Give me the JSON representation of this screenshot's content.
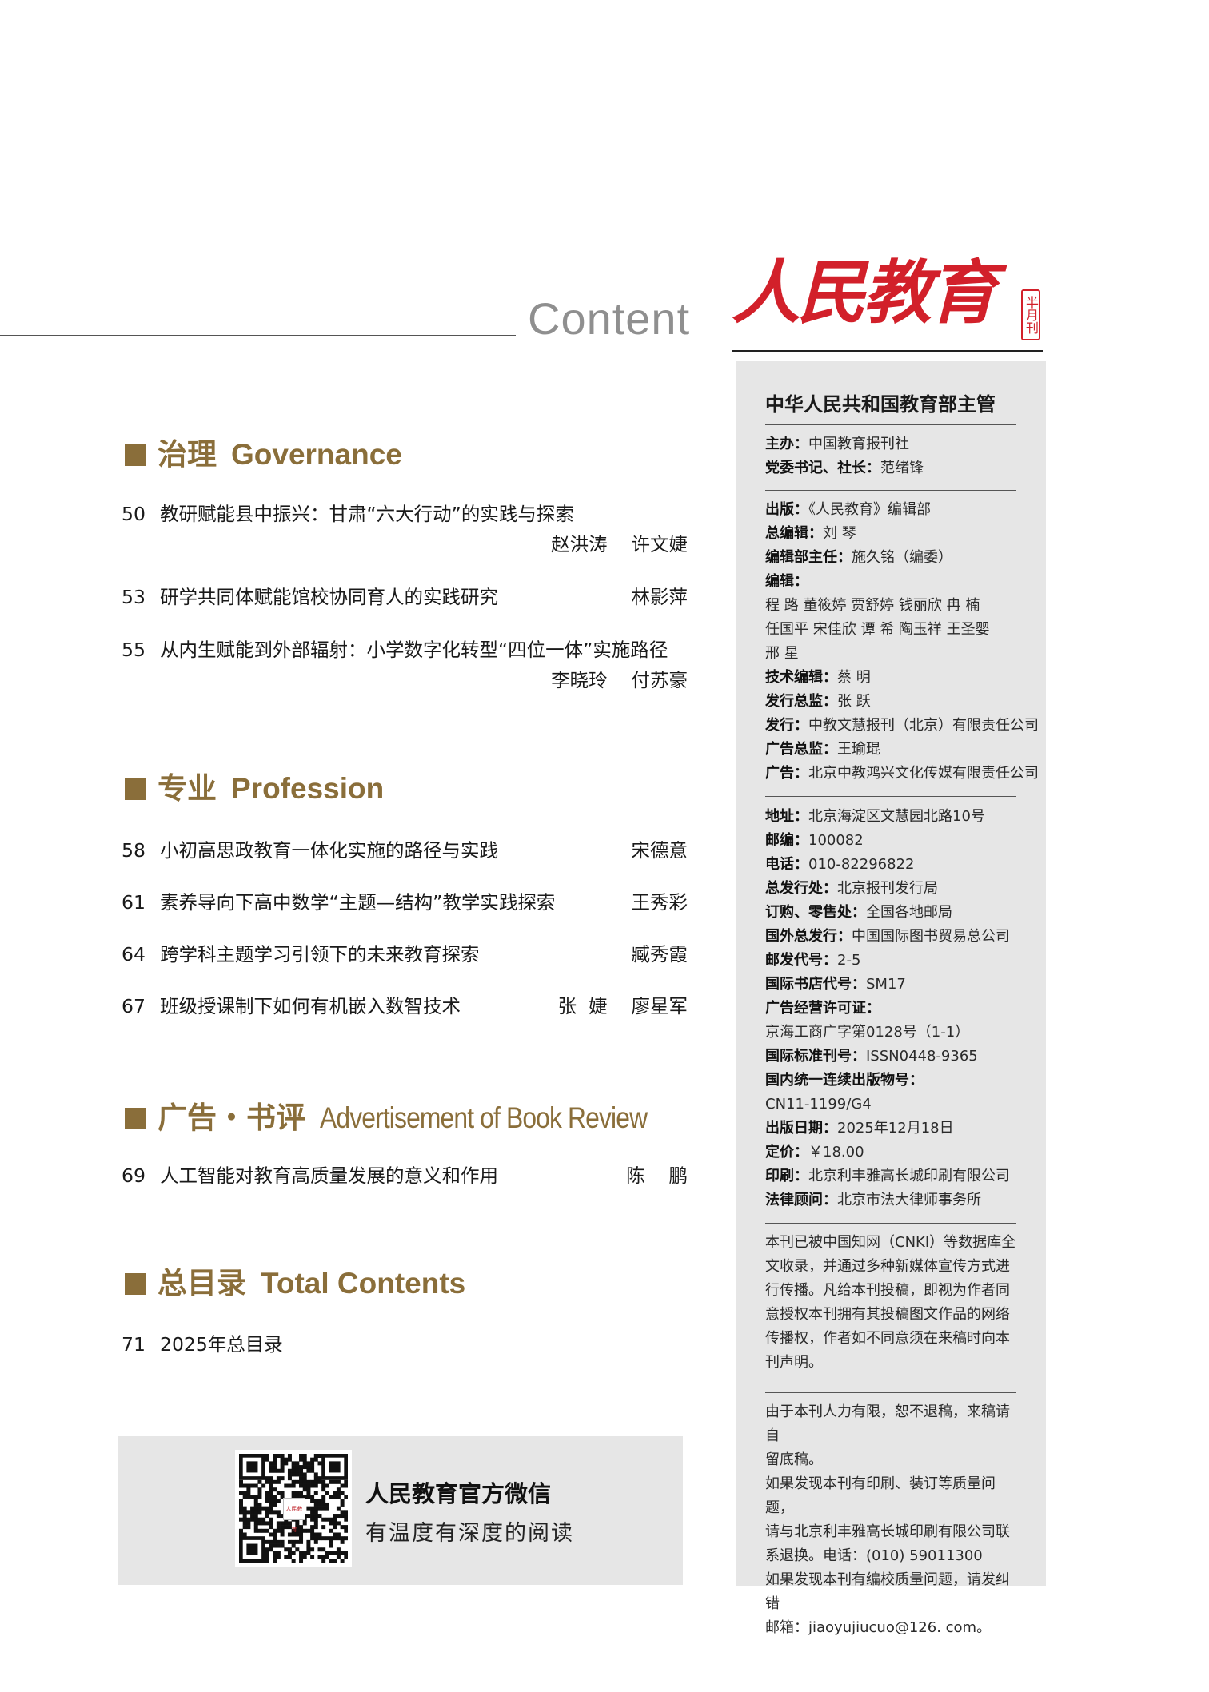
{
  "header": {
    "content_word": "Content",
    "masthead_title": "人民教育",
    "masthead_seal": "半月刊"
  },
  "sections": [
    {
      "cn": "治理",
      "en": "Governance",
      "items": [
        {
          "num": "50",
          "title": "教研赋能县中振兴：甘肃“六大行动”的实践与探索",
          "author": "赵洪涛    许文婕"
        },
        {
          "num": "53",
          "title": "研学共同体赋能馆校协同育人的实践研究",
          "author": "林影萍"
        },
        {
          "num": "55",
          "title": "从内生赋能到外部辐射：小学数字化转型“四位一体”实施路径",
          "author": "李晓玲    付苏豪"
        }
      ]
    },
    {
      "cn": "专业",
      "en": "Profession",
      "items": [
        {
          "num": "58",
          "title": "小初高思政教育一体化实施的路径与实践",
          "author": "宋德意"
        },
        {
          "num": "61",
          "title": "素养导向下高中数学“主题—结构”教学实践探索",
          "author": "王秀彩"
        },
        {
          "num": "64",
          "title": "跨学科主题学习引领下的未来教育探索",
          "author": "臧秀霞"
        },
        {
          "num": "67",
          "title": "班级授课制下如何有机嵌入数智技术",
          "author": "张  婕    廖星军"
        }
      ]
    },
    {
      "cn": "广告・书评",
      "en": "Advertisement  of  Book Review",
      "items": [
        {
          "num": "69",
          "title": "人工智能对教育高质量发展的意义和作用",
          "author": "陈    鹏"
        }
      ]
    },
    {
      "cn": "总目录",
      "en": "Total  Contents",
      "items": [
        {
          "num": "71",
          "title": "2025年总目录",
          "author": ""
        }
      ]
    }
  ],
  "wechat": {
    "title": "人民教育官方微信",
    "subtitle": "有温度有深度的阅读",
    "qr_logo_text": "人民教育"
  },
  "info": {
    "supervisor": "中华人民共和国教育部主管",
    "block1": [
      {
        "label": "主办：",
        "value": "中国教育报刊社"
      },
      {
        "label": "党委书记、社长：",
        "value": "范绪锋"
      }
    ],
    "block2": [
      {
        "label": "出版：",
        "value": "《人民教育》编辑部"
      },
      {
        "label": "总编辑：",
        "value": "刘    琴"
      },
      {
        "label": "编辑部主任：",
        "value": "施久铭（编委）"
      },
      {
        "label": "编辑：",
        "value": ""
      },
      {
        "label": "",
        "value": "程    路    董筱婷    贾舒婷    钱丽欣    冉    楠"
      },
      {
        "label": "",
        "value": "任国平    宋佳欣    谭    希    陶玉祥    王圣婴"
      },
      {
        "label": "",
        "value": "邢    星"
      },
      {
        "label": "技术编辑：",
        "value": "蔡    明"
      },
      {
        "label": "发行总监：",
        "value": "张    跃"
      },
      {
        "label": "发行：",
        "value": "中教文慧报刊（北京）有限责任公司"
      },
      {
        "label": "广告总监：",
        "value": "王瑜琨"
      },
      {
        "label": "广告：",
        "value": "北京中教鸿兴文化传媒有限责任公司"
      }
    ],
    "block3": [
      {
        "label": "地址：",
        "value": "北京海淀区文慧园北路10号"
      },
      {
        "label": "邮编：",
        "value": "100082"
      },
      {
        "label": "电话：",
        "value": "010-82296822"
      },
      {
        "label": "总发行处：",
        "value": "北京报刊发行局"
      },
      {
        "label": "订购、零售处：",
        "value": "全国各地邮局"
      },
      {
        "label": "国外总发行：",
        "value": "中国国际图书贸易总公司"
      },
      {
        "label": "邮发代号：",
        "value": "2-5"
      },
      {
        "label": "国际书店代号：",
        "value": "SM17"
      },
      {
        "label": "广告经营许可证：",
        "value": ""
      },
      {
        "label": "",
        "value": "京海工商广字第0128号（1-1）"
      },
      {
        "label": "国际标准刊号：",
        "value": "ISSN0448-9365"
      },
      {
        "label": "国内统一连续出版物号：",
        "value": ""
      },
      {
        "label": "",
        "value": "CN11-1199/G4"
      },
      {
        "label": "出版日期：",
        "value": "2025年12月18日"
      },
      {
        "label": "定价：",
        "value": "￥18.00"
      },
      {
        "label": "印刷：",
        "value": "北京利丰雅高长城印刷有限公司"
      },
      {
        "label": "法律顾问：",
        "value": "北京市法大律师事务所"
      }
    ],
    "notice1": [
      "本刊已被中国知网（CNKI）等数据库全",
      "文收录，并通过多种新媒体宣传方式进",
      "行传播。凡给本刊投稿，即视为作者同",
      "意授权本刊拥有其投稿图文作品的网络",
      "传播权，作者如不同意须在来稿时向本",
      "刊声明。"
    ],
    "notice2": [
      "由于本刊人力有限，恕不退稿，来稿请自",
      "留底稿。",
      "如果发现本刊有印刷、装订等质量问题，",
      "请与北京利丰雅高长城印刷有限公司联",
      "系退换。电话：(010) 59011300",
      "如果发现本刊有编校质量问题，请发纠错",
      "邮箱：jiaoyujiucuo@126. com。"
    ]
  }
}
